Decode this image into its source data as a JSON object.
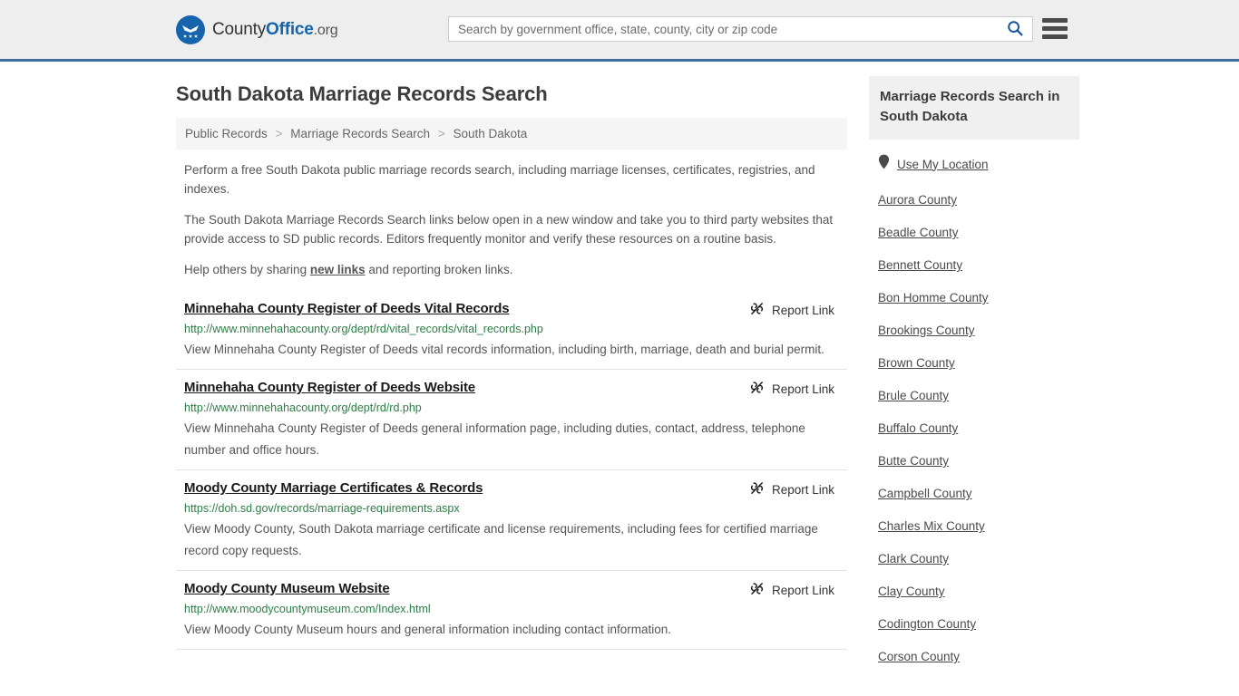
{
  "header": {
    "logo": {
      "icon": "eagle-shield-logo-icon",
      "text_county": "County",
      "text_office": "Office",
      "text_org": ".org"
    },
    "search": {
      "placeholder": "Search by government office, state, county, city or zip code",
      "value": "",
      "search_icon": "search-icon"
    },
    "menu_icon": "hamburger-menu-icon"
  },
  "main": {
    "page_title": "South Dakota Marriage Records Search",
    "breadcrumb": [
      {
        "label": "Public Records",
        "current": false
      },
      {
        "label": "Marriage Records Search",
        "current": false
      },
      {
        "label": "South Dakota",
        "current": true
      }
    ],
    "breadcrumb_separator": ">",
    "intro": {
      "p1": "Perform a free South Dakota public marriage records search, including marriage licenses, certificates, registries, and indexes.",
      "p2": "The South Dakota Marriage Records Search links below open in a new window and take you to third party websites that provide access to SD public records. Editors frequently monitor and verify these resources on a routine basis.",
      "p3_before": "Help others by sharing ",
      "p3_link": "new links",
      "p3_after": " and reporting broken links."
    },
    "report_link_label": "Report Link",
    "report_link_icon": "broken-link-icon",
    "results": [
      {
        "title": "Minnehaha County Register of Deeds Vital Records",
        "url": "http://www.minnehahacounty.org/dept/rd/vital_records/vital_records.php",
        "description": "View Minnehaha County Register of Deeds vital records information, including birth, marriage, death and burial permit."
      },
      {
        "title": "Minnehaha County Register of Deeds Website",
        "url": "http://www.minnehahacounty.org/dept/rd/rd.php",
        "description": "View Minnehaha County Register of Deeds general information page, including duties, contact, address, telephone number and office hours."
      },
      {
        "title": "Moody County Marriage Certificates & Records",
        "url": "https://doh.sd.gov/records/marriage-requirements.aspx",
        "description": "View Moody County, South Dakota marriage certificate and license requirements, including fees for certified marriage record copy requests."
      },
      {
        "title": "Moody County Museum Website",
        "url": "http://www.moodycountymuseum.com/Index.html",
        "description": "View Moody County Museum hours and general information including contact information."
      }
    ]
  },
  "sidebar": {
    "heading": "Marriage Records Search in South Dakota",
    "use_my_location": {
      "label": "Use My Location",
      "icon": "map-pin-icon"
    },
    "counties": [
      "Aurora County",
      "Beadle County",
      "Bennett County",
      "Bon Homme County",
      "Brookings County",
      "Brown County",
      "Brule County",
      "Buffalo County",
      "Butte County",
      "Campbell County",
      "Charles Mix County",
      "Clark County",
      "Clay County",
      "Codington County",
      "Corson County"
    ]
  },
  "colors": {
    "brand_blue": "#1664ab",
    "header_rule": "#3d6e9e",
    "header_bg": "#eeeeee",
    "url_green": "#2e7d45",
    "breadcrumb_bg": "#f5f5f5",
    "sidebar_head_bg": "#f0f0f0"
  }
}
